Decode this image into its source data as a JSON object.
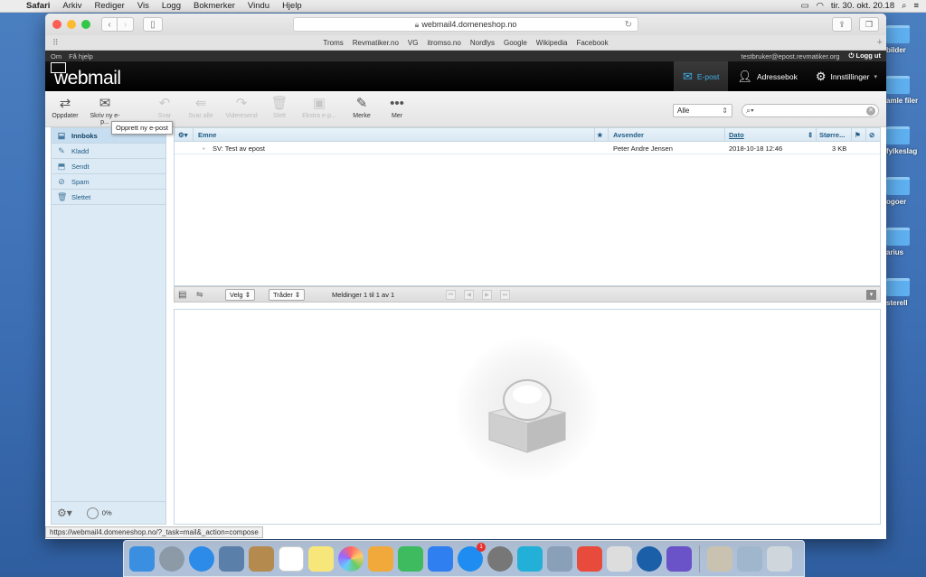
{
  "menubar": {
    "app": "Safari",
    "items": [
      "Arkiv",
      "Rediger",
      "Vis",
      "Logg",
      "Bokmerker",
      "Vindu",
      "Hjelp"
    ],
    "clock": "tir. 30. okt. 20.18"
  },
  "desktop": {
    "labels": [
      "bilder",
      "amle filer",
      "fylkeslag",
      "ogoer",
      "arius",
      "sterell"
    ]
  },
  "browser": {
    "url": "webmail4.domeneshop.no",
    "favorites": [
      "Troms",
      "Revmatiker.no",
      "VG",
      "itromso.no",
      "Nordlys",
      "Google",
      "Wikipedia",
      "Facebook"
    ],
    "status_url": "https://webmail4.domeneshop.no/?_task=mail&_action=compose"
  },
  "webmail": {
    "topline": {
      "about": "Om",
      "help": "Få hjelp",
      "user": "testbruker@epost.revmatiker.org",
      "logout": "Logg ut"
    },
    "logo": "webmail",
    "nav": [
      {
        "label": "E-post",
        "icon": "envelope-icon"
      },
      {
        "label": "Adressebok",
        "icon": "person-icon"
      },
      {
        "label": "Innstillinger",
        "icon": "gear-icon"
      }
    ],
    "toolbar": {
      "refresh": "Oppdater",
      "compose": "Skriv ny e-p...",
      "reply": "Svar",
      "reply_all": "Svar alle",
      "forward": "Videresend",
      "delete": "Slett",
      "archive": "Ekstra e-p...",
      "mark": "Merke",
      "more": "Mer",
      "tooltip": "Opprett ny e-post",
      "filter": "Alle",
      "search_placeholder": ""
    },
    "folders": [
      {
        "label": "Innboks",
        "icon": "inbox-icon"
      },
      {
        "label": "Kladd",
        "icon": "pencil-icon"
      },
      {
        "label": "Sendt",
        "icon": "sent-icon"
      },
      {
        "label": "Spam",
        "icon": "spam-icon"
      },
      {
        "label": "Slettet",
        "icon": "trash-icon"
      }
    ],
    "quota": "0%",
    "list": {
      "headers": {
        "subject": "Emne",
        "sender": "Avsender",
        "date": "Dato",
        "size": "Større..."
      },
      "rows": [
        {
          "subject": "SV: Test av epost",
          "sender": "Peter Andre Jensen",
          "date": "2018-10-18 12:46",
          "size": "3 KB"
        }
      ],
      "footer": {
        "select": "Velg",
        "threads": "Tråder",
        "count": "Meldinger 1 til 1 av 1"
      }
    }
  }
}
